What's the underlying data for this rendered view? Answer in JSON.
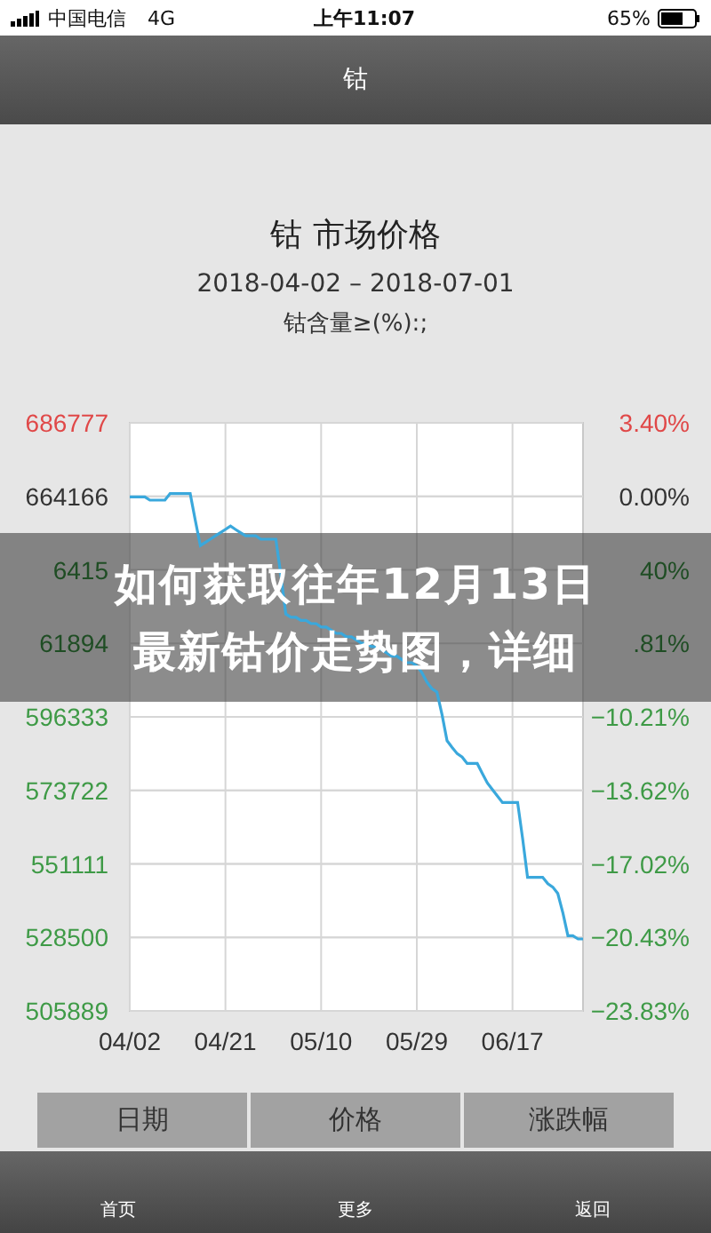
{
  "status_bar": {
    "carrier": "中国电信",
    "network": "4G",
    "time": "上午11:07",
    "battery": "65%"
  },
  "nav_bar": {
    "title": "钴"
  },
  "header": {
    "title": "钴 市场价格",
    "date_range": "2018-04-02 – 2018-07-01",
    "subtitle": "钴含量≥(%):;"
  },
  "chart": {
    "chart_data": {
      "type": "line",
      "categories": [
        "04/02",
        null,
        null,
        null,
        null,
        null,
        null,
        null,
        null,
        null,
        null,
        null,
        null,
        null,
        null,
        null,
        null,
        null,
        null,
        "04/21",
        null,
        null,
        null,
        null,
        null,
        null,
        null,
        null,
        null,
        null,
        null,
        null,
        null,
        null,
        null,
        null,
        null,
        null,
        "05/10",
        null,
        null,
        null,
        null,
        null,
        null,
        null,
        null,
        null,
        null,
        null,
        null,
        null,
        null,
        null,
        null,
        null,
        null,
        "05/29",
        null,
        null,
        null,
        null,
        null,
        null,
        null,
        null,
        null,
        null,
        null,
        null,
        null,
        null,
        null,
        null,
        null,
        null,
        "06/17",
        null,
        null,
        null,
        null,
        null,
        null,
        null,
        null,
        null,
        null,
        null,
        null,
        null,
        null
      ],
      "series": [
        {
          "color": "#3aa8dc",
          "values": [
            664000,
            664000,
            664000,
            664000,
            663000,
            663000,
            663000,
            663000,
            665000,
            665000,
            665000,
            665000,
            665000,
            657000,
            649000,
            650000,
            651000,
            652000,
            653000,
            654000,
            655000,
            654000,
            653000,
            652000,
            652000,
            652000,
            651000,
            651000,
            651000,
            651000,
            640000,
            628000,
            627000,
            627000,
            626000,
            626000,
            625000,
            625000,
            624000,
            624000,
            623000,
            622000,
            622000,
            621000,
            621000,
            620000,
            619000,
            619000,
            618000,
            618000,
            617000,
            616000,
            615000,
            615000,
            614000,
            613000,
            613000,
            612000,
            610000,
            607000,
            605000,
            604000,
            597000,
            589000,
            587000,
            585000,
            584000,
            582000,
            582000,
            582000,
            579000,
            576000,
            574000,
            572000,
            570000,
            570000,
            570000,
            570000,
            559000,
            547000,
            547000,
            547000,
            547000,
            545000,
            544000,
            542000,
            536000,
            529000,
            529000,
            528000,
            528000
          ]
        }
      ],
      "ylim": [
        505889,
        686777
      ],
      "yticks": [
        686777,
        664166,
        596333,
        573722,
        551111,
        528500,
        505889
      ],
      "grid": true
    },
    "left_labels": [
      {
        "text": "686777",
        "color": "#e04848"
      },
      {
        "text": "664166",
        "color": "#333333"
      },
      {
        "text": "6415",
        "color": "#1f4d24"
      },
      {
        "text": "61894",
        "color": "#1f4d24"
      },
      {
        "text": "596333",
        "color": "#3e9a46"
      },
      {
        "text": "573722",
        "color": "#3e9a46"
      },
      {
        "text": "551111",
        "color": "#3e9a46"
      },
      {
        "text": "528500",
        "color": "#3e9a46"
      },
      {
        "text": "505889",
        "color": "#3e9a46"
      }
    ],
    "right_labels": [
      {
        "text": "3.40%",
        "color": "#e04848"
      },
      {
        "text": "0.00%",
        "color": "#333333"
      },
      {
        "text": "40%",
        "color": "#1f4d24"
      },
      {
        "text": ".81%",
        "color": "#1f4d24"
      },
      {
        "text": "−10.21%",
        "color": "#3e9a46"
      },
      {
        "text": "−13.62%",
        "color": "#3e9a46"
      },
      {
        "text": "−17.02%",
        "color": "#3e9a46"
      },
      {
        "text": "−20.43%",
        "color": "#3e9a46"
      },
      {
        "text": "−23.83%",
        "color": "#3e9a46"
      }
    ]
  },
  "columns": [
    "日期",
    "价格",
    "涨跌幅"
  ],
  "overlay": {
    "lines": [
      "如何获取往年12月13日",
      "最新钴价走势图，详细"
    ]
  },
  "tab_bar": [
    "首页",
    "更多",
    "返回"
  ]
}
